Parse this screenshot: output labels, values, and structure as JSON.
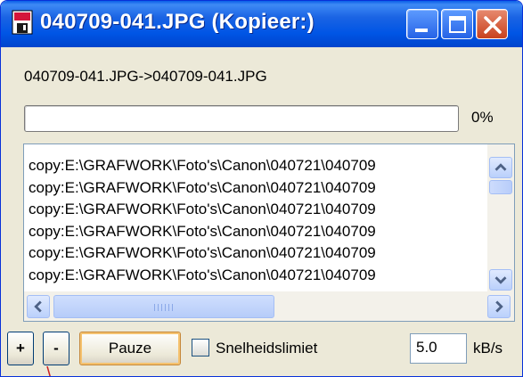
{
  "window": {
    "title": "040709-041.JPG (Kopieer:)",
    "controls": {
      "minimize": "minimize",
      "maximize": "maximize",
      "close": "close"
    }
  },
  "transfer": {
    "source_dest": "040709-041.JPG->040709-041.JPG",
    "progress_fraction": 0.0,
    "progress_label": "0%"
  },
  "log": {
    "lines": [
      "copy:E:\\GRAFWORK\\Foto's\\Canon\\040721\\040709",
      "copy:E:\\GRAFWORK\\Foto's\\Canon\\040721\\040709",
      "copy:E:\\GRAFWORK\\Foto's\\Canon\\040721\\040709",
      "copy:E:\\GRAFWORK\\Foto's\\Canon\\040721\\040709",
      "copy:E:\\GRAFWORK\\Foto's\\Canon\\040721\\040709",
      "copy:E:\\GRAFWORK\\Foto's\\Canon\\040721\\040709"
    ],
    "hscroll_grip": "IIII"
  },
  "controls": {
    "plus_label": "+",
    "minus_label": "-",
    "pause_label": "Pauze",
    "speed_limit_label": "Snelheidslimiet",
    "speed_limit_checked": false,
    "speed_value": "5.0",
    "speed_unit": "kB/s"
  },
  "colors": {
    "titlebar": "#0055e5",
    "window_bg": "#ece9d8",
    "close_button": "#c8421e",
    "pause_focus": "#f5c26f"
  }
}
